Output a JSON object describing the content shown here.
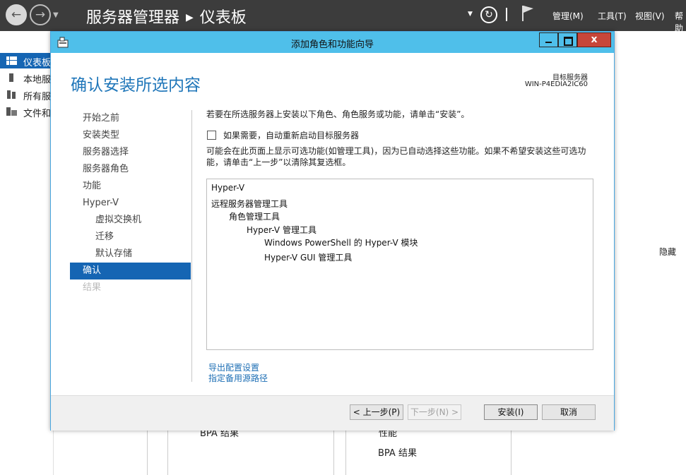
{
  "server_manager": {
    "breadcrumb_app": "服务器管理器",
    "breadcrumb_page": "仪表板",
    "menus": [
      "管理(M)",
      "工具(T)",
      "视图(V)",
      "帮助"
    ],
    "sidebar": [
      "仪表板",
      "本地服",
      "所有服",
      "文件和"
    ],
    "hide_label": "隐藏",
    "bg_bpa_1": "BPA 结果",
    "bg_perf": "性能",
    "bg_bpa_2": "BPA 结果"
  },
  "wizard": {
    "title": "添加角色和功能向导",
    "close_glyph": "x",
    "heading": "确认安装所选内容",
    "destination_label": "目标服务器",
    "destination_server": "WIN-P4EDIA2IC60",
    "nav": [
      {
        "label": "开始之前",
        "state": "normal"
      },
      {
        "label": "安装类型",
        "state": "normal"
      },
      {
        "label": "服务器选择",
        "state": "normal"
      },
      {
        "label": "服务器角色",
        "state": "normal"
      },
      {
        "label": "功能",
        "state": "normal"
      },
      {
        "label": "Hyper-V",
        "state": "normal"
      },
      {
        "label": "虚拟交换机",
        "state": "sub"
      },
      {
        "label": "迁移",
        "state": "sub"
      },
      {
        "label": "默认存储",
        "state": "sub"
      },
      {
        "label": "确认",
        "state": "active"
      },
      {
        "label": "结果",
        "state": "disabled"
      }
    ],
    "intro": "若要在所选服务器上安装以下角色、角色服务或功能，请单击“安装”。",
    "restart_checkbox": "如果需要，自动重新启动目标服务器",
    "restart_checked": false,
    "note": "可能会在此页面上显示可选功能(如管理工具)，因为已自动选择这些功能。如果不希望安装这些可选功能，请单击“上一步”以清除其复选框。",
    "features": [
      {
        "label": "Hyper-V",
        "level": 0
      },
      {
        "label": "远程服务器管理工具",
        "level": 0
      },
      {
        "label": "角色管理工具",
        "level": 1
      },
      {
        "label": "Hyper-V 管理工具",
        "level": 2
      },
      {
        "label": "Windows PowerShell 的 Hyper-V 模块",
        "level": 3
      },
      {
        "label": "Hyper-V GUI 管理工具",
        "level": 3
      }
    ],
    "link_export": "导出配置设置",
    "link_alt_source": "指定备用源路径",
    "buttons": {
      "previous": "< 上一步(P)",
      "next": "下一步(N) >",
      "install": "安装(I)",
      "cancel": "取消"
    }
  },
  "colors": {
    "accent": "#1565b3",
    "titlebar": "#4fbfea",
    "heading": "#1f76b9",
    "link": "#1e6fb5",
    "close": "#c7463a",
    "header_bg": "#3c3c3c"
  }
}
